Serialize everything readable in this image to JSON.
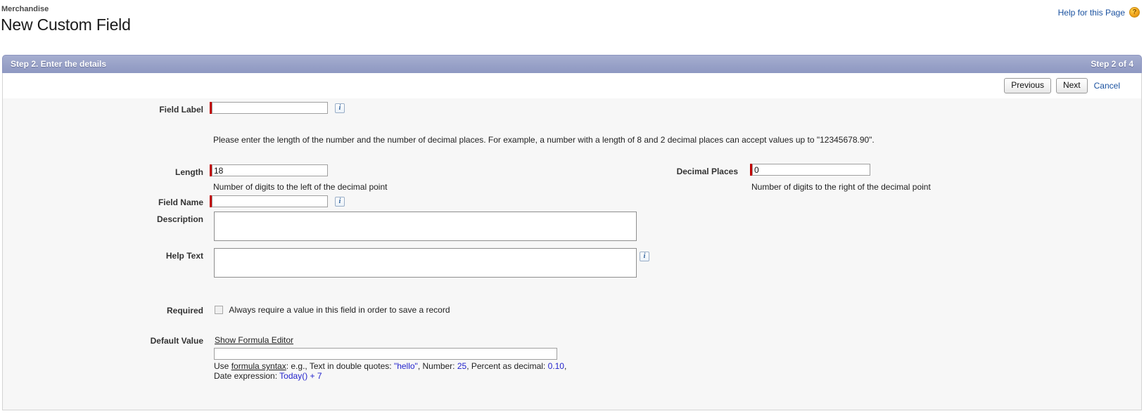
{
  "header": {
    "breadcrumb": "Merchandise",
    "title": "New Custom Field",
    "help_link": "Help for this Page",
    "help_icon": "question-mark-circle-icon"
  },
  "step_bar": {
    "title": "Step 2. Enter the details",
    "count": "Step 2 of 4",
    "background_color": "#99a2c8"
  },
  "toolbar": {
    "previous_label": "Previous",
    "next_label": "Next",
    "cancel_label": "Cancel"
  },
  "form": {
    "field_label": {
      "label": "Field Label",
      "value": "",
      "required": true,
      "info_icon": "info-icon"
    },
    "description_note": "Please enter the length of the number and the number of decimal places. For example, a number with a length of 8 and 2 decimal places can accept values up to \"12345678.90\".",
    "length": {
      "label": "Length",
      "value": "18",
      "required": true,
      "hint": "Number of digits to the left of the decimal point"
    },
    "decimal_places": {
      "label": "Decimal Places",
      "value": "0",
      "required": true,
      "hint": "Number of digits to the right of the decimal point"
    },
    "field_name": {
      "label": "Field Name",
      "value": "",
      "required": true,
      "info_icon": "info-icon"
    },
    "description": {
      "label": "Description",
      "value": ""
    },
    "help_text": {
      "label": "Help Text",
      "value": "",
      "info_icon": "info-icon"
    },
    "required_field": {
      "label": "Required",
      "checkbox_label": "Always require a value in this field in order to save a record",
      "checked": false
    },
    "default_value": {
      "label": "Default Value",
      "formula_link": "Show Formula Editor",
      "value": "",
      "syntax_prefix": "Use ",
      "syntax_link": "formula syntax",
      "syntax_mid": ": e.g., Text in double quotes: ",
      "syntax_text_example": "\"hello\"",
      "syntax_number_label": ", Number: ",
      "syntax_number_example": "25",
      "syntax_percent_label": ", Percent as decimal: ",
      "syntax_percent_example": "0.10",
      "syntax_comma": ",",
      "syntax_date_label": "Date expression: ",
      "syntax_date_example": "Today() + 7"
    }
  }
}
